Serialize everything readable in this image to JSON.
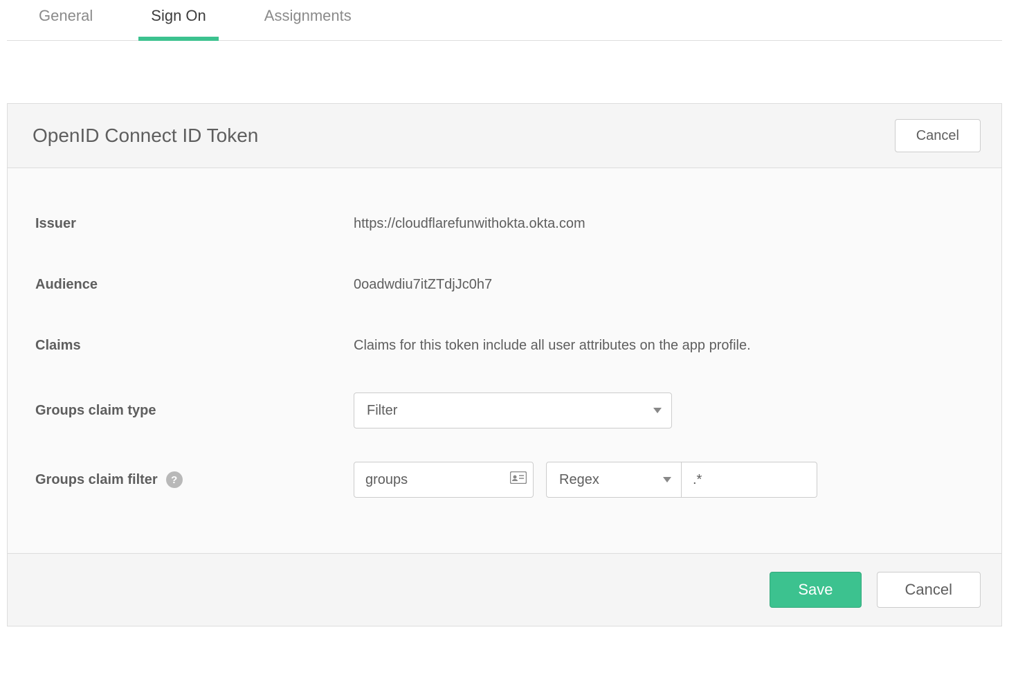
{
  "tabs": {
    "general": "General",
    "signon": "Sign On",
    "assignments": "Assignments"
  },
  "panel": {
    "title": "OpenID Connect ID Token",
    "cancel_top": "Cancel"
  },
  "form": {
    "issuer_label": "Issuer",
    "issuer_value": "https://cloudflarefunwithokta.okta.com",
    "audience_label": "Audience",
    "audience_value": "0oadwdiu7itZTdjJc0h7",
    "claims_label": "Claims",
    "claims_value": "Claims for this token include all user attributes on the app profile.",
    "groups_claim_type_label": "Groups claim type",
    "groups_claim_type_value": "Filter",
    "groups_claim_filter_label": "Groups claim filter",
    "groups_claim_filter_name": "groups",
    "groups_claim_filter_match": "Regex",
    "groups_claim_filter_value": ".*"
  },
  "footer": {
    "save": "Save",
    "cancel": "Cancel"
  }
}
